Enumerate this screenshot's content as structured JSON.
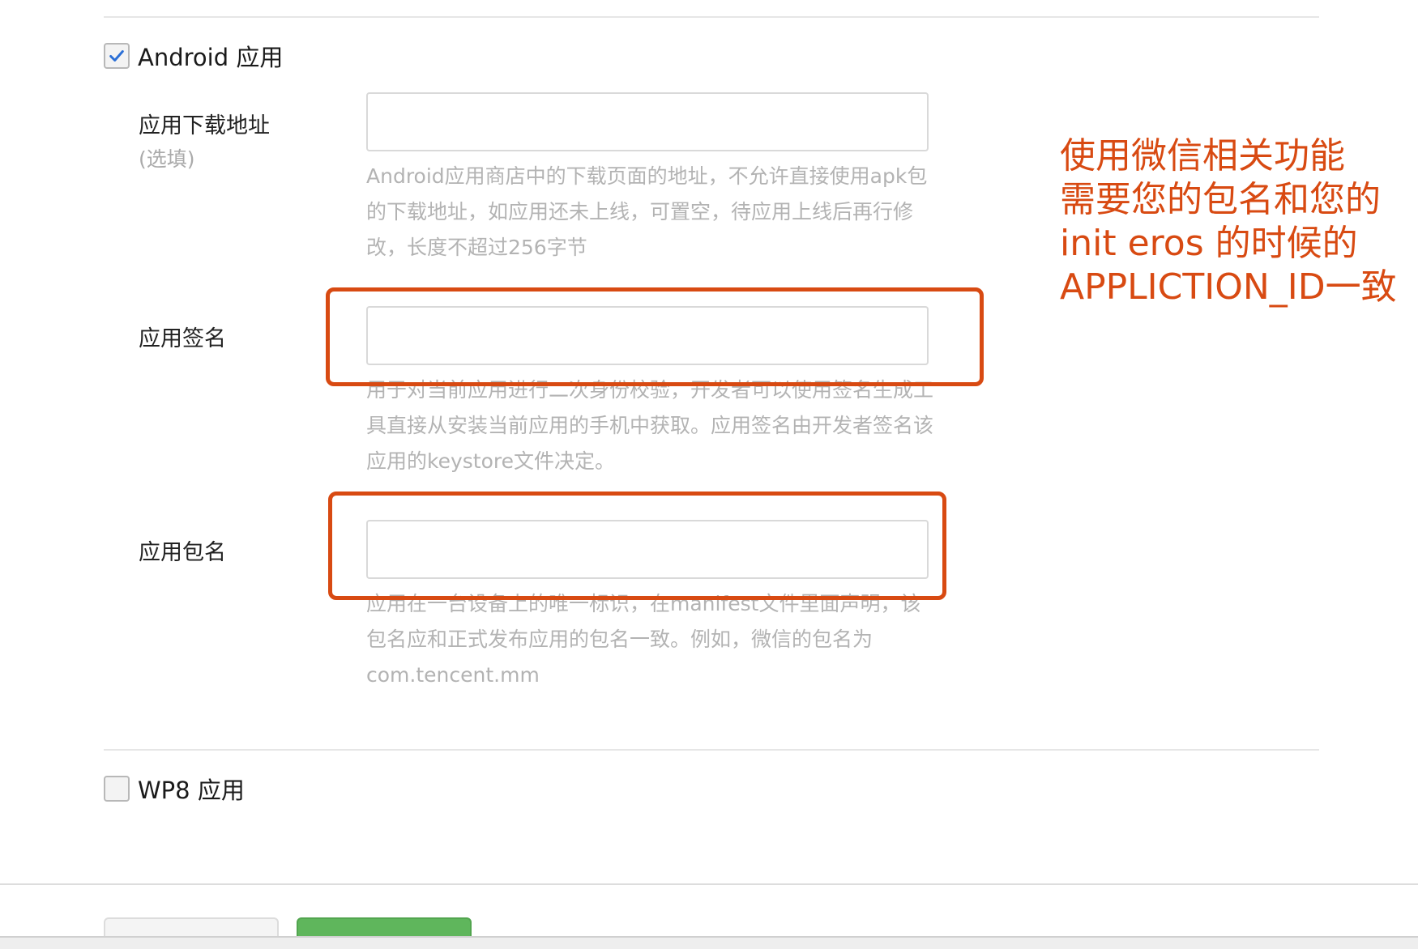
{
  "android_section": {
    "label": "Android 应用",
    "checked": true,
    "download_url": {
      "label": "应用下载地址",
      "optional": "(选填)",
      "value": "",
      "help": "Android应用商店中的下载页面的地址，不允许直接使用apk包的下载地址，如应用还未上线，可置空，待应用上线后再行修改，长度不超过256字节"
    },
    "signature": {
      "label": "应用签名",
      "value": "",
      "help": "用于对当前应用进行二次身份校验，开发者可以使用签名生成工具直接从安装当前应用的手机中获取。应用签名由开发者签名该应用的keystore文件决定。"
    },
    "package_name": {
      "label": "应用包名",
      "value": "",
      "help": "应用在一台设备上的唯一标识，在manifest文件里面声明，该包名应和正式发布应用的包名一致。例如，微信的包名为com.tencent.mm"
    }
  },
  "wp8_section": {
    "label": "WP8 应用",
    "checked": false
  },
  "annotation": {
    "text": "使用微信相关功能\n需要您的包名和您的\ninit  eros 的时候的\nAPPLICTION_ID一致",
    "color": "#d84a12"
  },
  "buttons": {
    "cancel": "",
    "submit": ""
  },
  "colors": {
    "highlight": "#d84a12",
    "checkmark": "#2b6fd6",
    "submit": "#5fb65c"
  }
}
